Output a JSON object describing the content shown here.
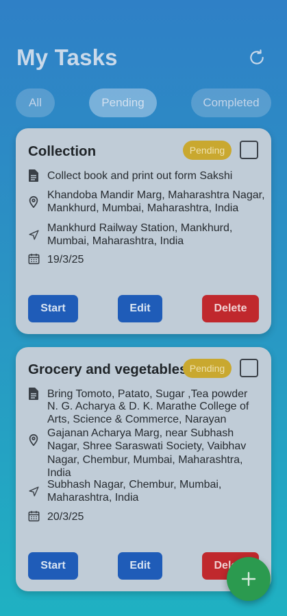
{
  "header": {
    "title": "My Tasks"
  },
  "filters": [
    "All",
    "Pending",
    "Completed"
  ],
  "tasks": [
    {
      "title": "Collection",
      "status": "Pending",
      "description": "Collect book and print out form Sakshi",
      "location": "Khandoba Mandir Marg, Maharashtra Nagar, Mankhurd, Mumbai, Maharashtra, India",
      "destination": "Mankhurd Railway Station, Mankhurd, Mumbai, Maharashtra, India",
      "date": "19/3/25",
      "actions": {
        "start": "Start",
        "edit": "Edit",
        "delete": "Delete"
      }
    },
    {
      "title": "Grocery and vegetables",
      "status": "Pending",
      "description": "Bring Tomoto, Patato, Sugar ,Tea powder",
      "location": "N. G. Acharya & D. K. Marathe College of Arts, Science & Commerce, Narayan Gajanan Acharya Marg, near Subhash Nagar, Shree Saraswati Society, Vaibhav Nagar, Chembur, Mumbai, Maharashtra, India",
      "destination": "Subhash Nagar, Chembur, Mumbai, Maharashtra, India",
      "date": "20/3/25",
      "actions": {
        "start": "Start",
        "edit": "Edit",
        "delete": "Delete"
      }
    }
  ]
}
